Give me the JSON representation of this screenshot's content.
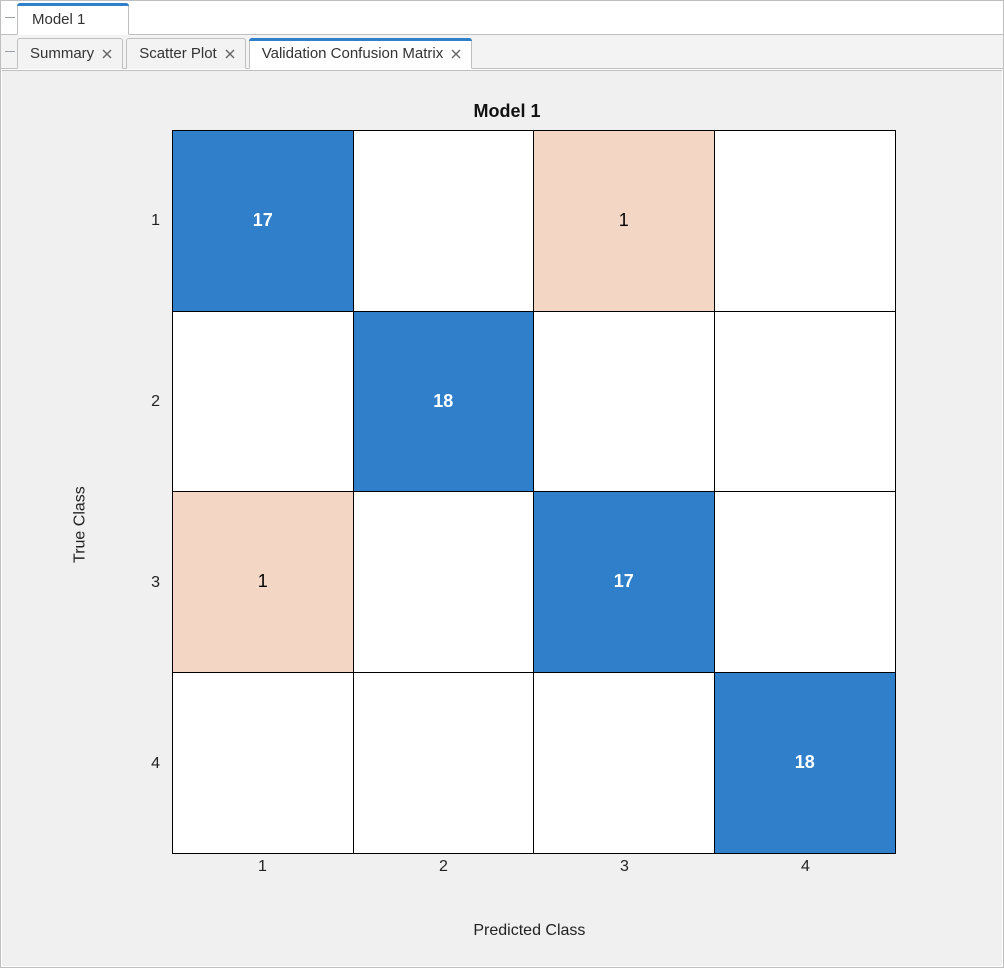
{
  "top_tabs": {
    "model": {
      "label": "Model 1"
    }
  },
  "sub_tabs": {
    "summary": {
      "label": "Summary"
    },
    "scatter": {
      "label": "Scatter Plot"
    },
    "confusion": {
      "label": "Validation Confusion Matrix"
    }
  },
  "chart_data": {
    "type": "heatmap",
    "title": "Model 1",
    "xlabel": "Predicted Class",
    "ylabel": "True Class",
    "x_categories": [
      "1",
      "2",
      "3",
      "4"
    ],
    "y_categories": [
      "1",
      "2",
      "3",
      "4"
    ],
    "matrix": [
      [
        17,
        null,
        1,
        null
      ],
      [
        null,
        18,
        null,
        null
      ],
      [
        1,
        null,
        17,
        null
      ],
      [
        null,
        null,
        null,
        18
      ]
    ],
    "cell_labels": [
      [
        "17",
        "",
        "1",
        ""
      ],
      [
        "",
        "18",
        "",
        ""
      ],
      [
        "1",
        "",
        "17",
        ""
      ],
      [
        "",
        "",
        "",
        "18"
      ]
    ],
    "colors": {
      "diagonal": "#2f7fcb",
      "off_diagonal": "#f3d7c4",
      "empty": "#ffffff"
    }
  }
}
